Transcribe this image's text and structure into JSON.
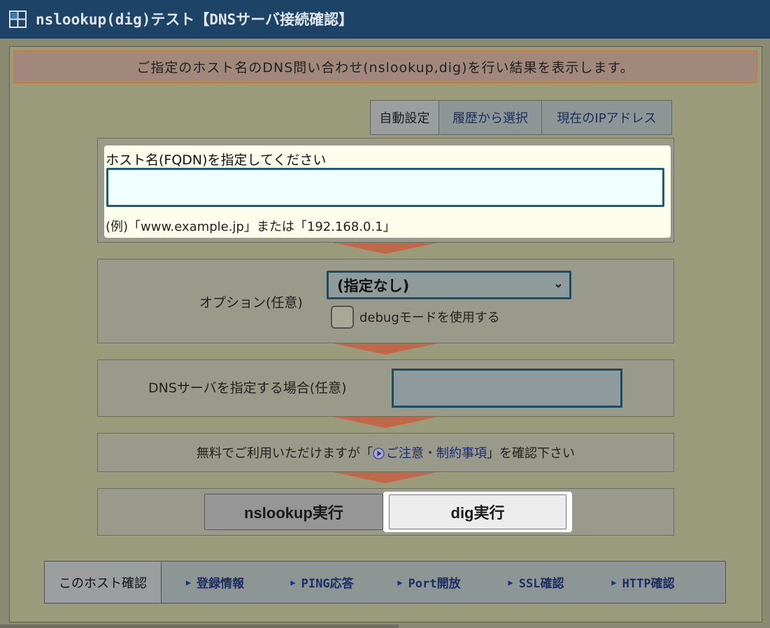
{
  "window": {
    "title": "nslookup(dig)テスト【DNSサーバ接続確認】"
  },
  "notice": "ご指定のホスト名のDNS問い合わせ(nslookup,dig)を行い結果を表示します。",
  "quick_tabs": [
    {
      "label": "自動設定"
    },
    {
      "label": "履歴から選択"
    },
    {
      "label": "現在のIPアドレス"
    }
  ],
  "host": {
    "label": "ホスト名(FQDN)を指定してください",
    "value": "",
    "example": "(例)「www.example.jp」または「192.168.0.1」"
  },
  "option": {
    "label": "オプション(任意)",
    "selected": "(指定なし)",
    "debug_label": "debugモードを使用する",
    "debug_checked": false
  },
  "dns_server": {
    "label": "DNSサーバを指定する場合(任意)",
    "value": ""
  },
  "terms": {
    "prefix": "無料でご利用いただけますが「",
    "link": "ご注意・制約事項",
    "suffix": "」を確認下さい"
  },
  "buttons": {
    "nslookup": "nslookup実行",
    "dig": "dig実行"
  },
  "host_links": {
    "title": "このホスト確認",
    "items": [
      {
        "label": "登録情報"
      },
      {
        "label": "PING応答"
      },
      {
        "label": "Port開放"
      },
      {
        "label": "SSL確認"
      },
      {
        "label": "HTTP確認"
      }
    ]
  },
  "colors": {
    "title_bar": "#1d4466",
    "arrow": "#c0684a",
    "link": "#1d2e62"
  }
}
